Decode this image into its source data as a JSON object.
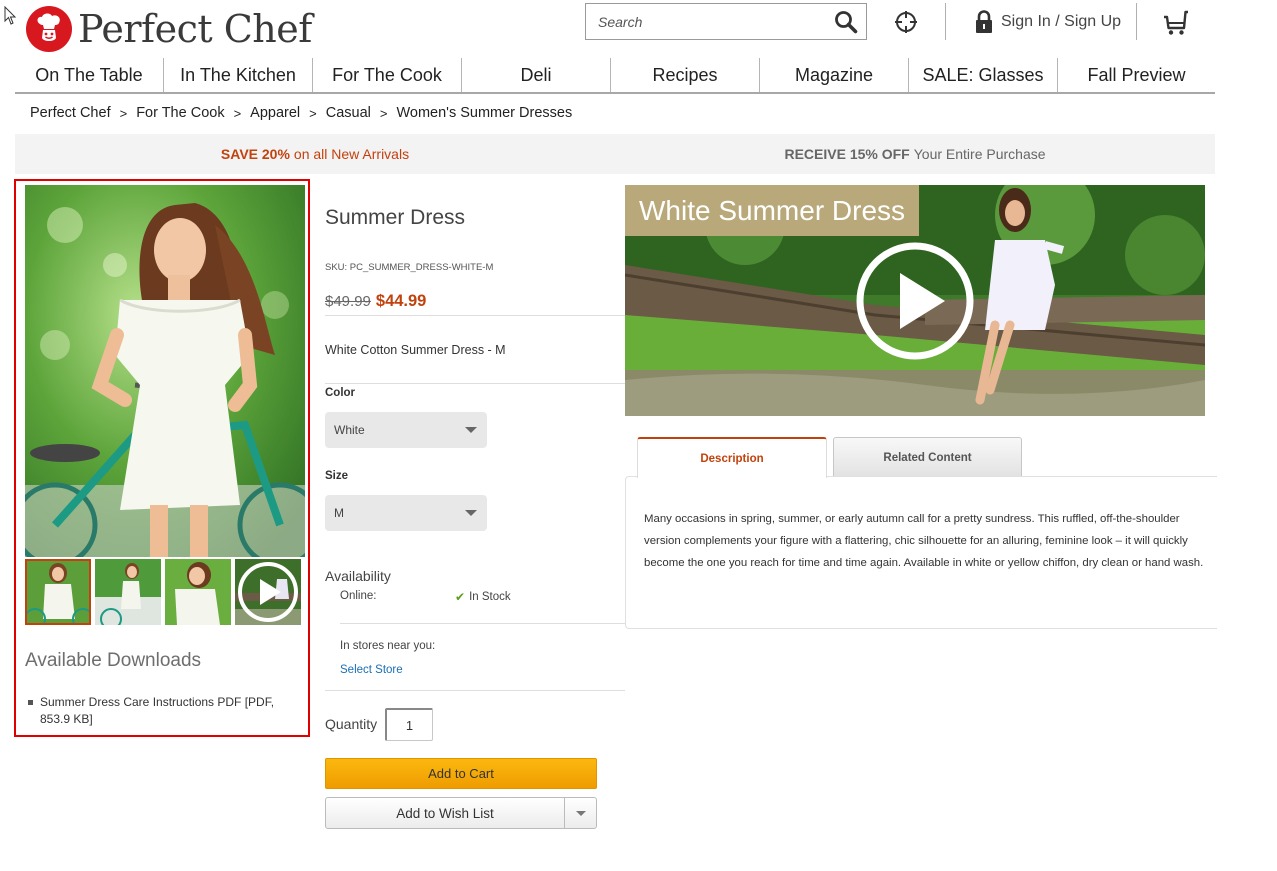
{
  "header": {
    "brand": "Perfect Chef",
    "search": {
      "placeholder": "Search",
      "value": ""
    },
    "signin_label": "Sign In / Sign Up"
  },
  "nav": {
    "items": [
      {
        "label": "On The Table"
      },
      {
        "label": "In The Kitchen"
      },
      {
        "label": "For The Cook"
      },
      {
        "label": "Deli"
      },
      {
        "label": "Recipes"
      },
      {
        "label": "Magazine"
      },
      {
        "label": "SALE: Glasses"
      },
      {
        "label": "Fall Preview"
      }
    ]
  },
  "breadcrumb": {
    "items": [
      "Perfect Chef",
      "For The Cook",
      "Apparel",
      "Casual",
      "Women's Summer Dresses"
    ],
    "separator": ">"
  },
  "promos": {
    "left": {
      "bold": "SAVE 20%",
      "text": "on all New Arrivals"
    },
    "right": {
      "bold": "RECEIVE 15% OFF",
      "text": "Your Entire Purchase"
    }
  },
  "gallery": {
    "thumbnail_count": 4,
    "active_thumbnail": 1,
    "last_thumbnail_is_video": true
  },
  "downloads": {
    "title": "Available Downloads",
    "items": [
      {
        "label": "Summer Dress Care Instructions PDF [PDF, 853.9 KB]"
      }
    ]
  },
  "product": {
    "title": "Summer Dress",
    "sku": "SKU: PC_SUMMER_DRESS-WHITE-M",
    "old_price": "$49.99",
    "price": "$44.99",
    "short_description": "White Cotton Summer Dress - M",
    "color_label": "Color",
    "color_value": "White",
    "size_label": "Size",
    "size_value": "M",
    "availability_title": "Availability",
    "online_label": "Online:",
    "online_status": "In Stock",
    "stores_label": "In stores near you:",
    "select_store": "Select Store",
    "quantity_label": "Quantity",
    "quantity_value": "1",
    "add_to_cart": "Add to Cart",
    "add_to_wishlist": "Add to Wish List"
  },
  "video": {
    "title": "White Summer Dress"
  },
  "tabs": {
    "items": [
      {
        "label": "Description",
        "active": true
      },
      {
        "label": "Related Content",
        "active": false
      }
    ],
    "description_text": "Many occasions in spring, summer, or early autumn call for a pretty sundress. This ruffled, off-the-shoulder version complements your figure with a flattering, chic silhouette for an alluring, feminine look – it will quickly become the one you reach for time and time again. Available in white or yellow chiffon, dry clean or hand wash."
  },
  "colors": {
    "brand_red": "#d8181f",
    "accent_orange": "#c2420e",
    "cart_button": "#f5a800",
    "video_title_bg": "#b9a97a",
    "link_blue": "#1a6fb5",
    "in_stock_green": "#5a9e1a",
    "highlight_border": "#e00000"
  }
}
